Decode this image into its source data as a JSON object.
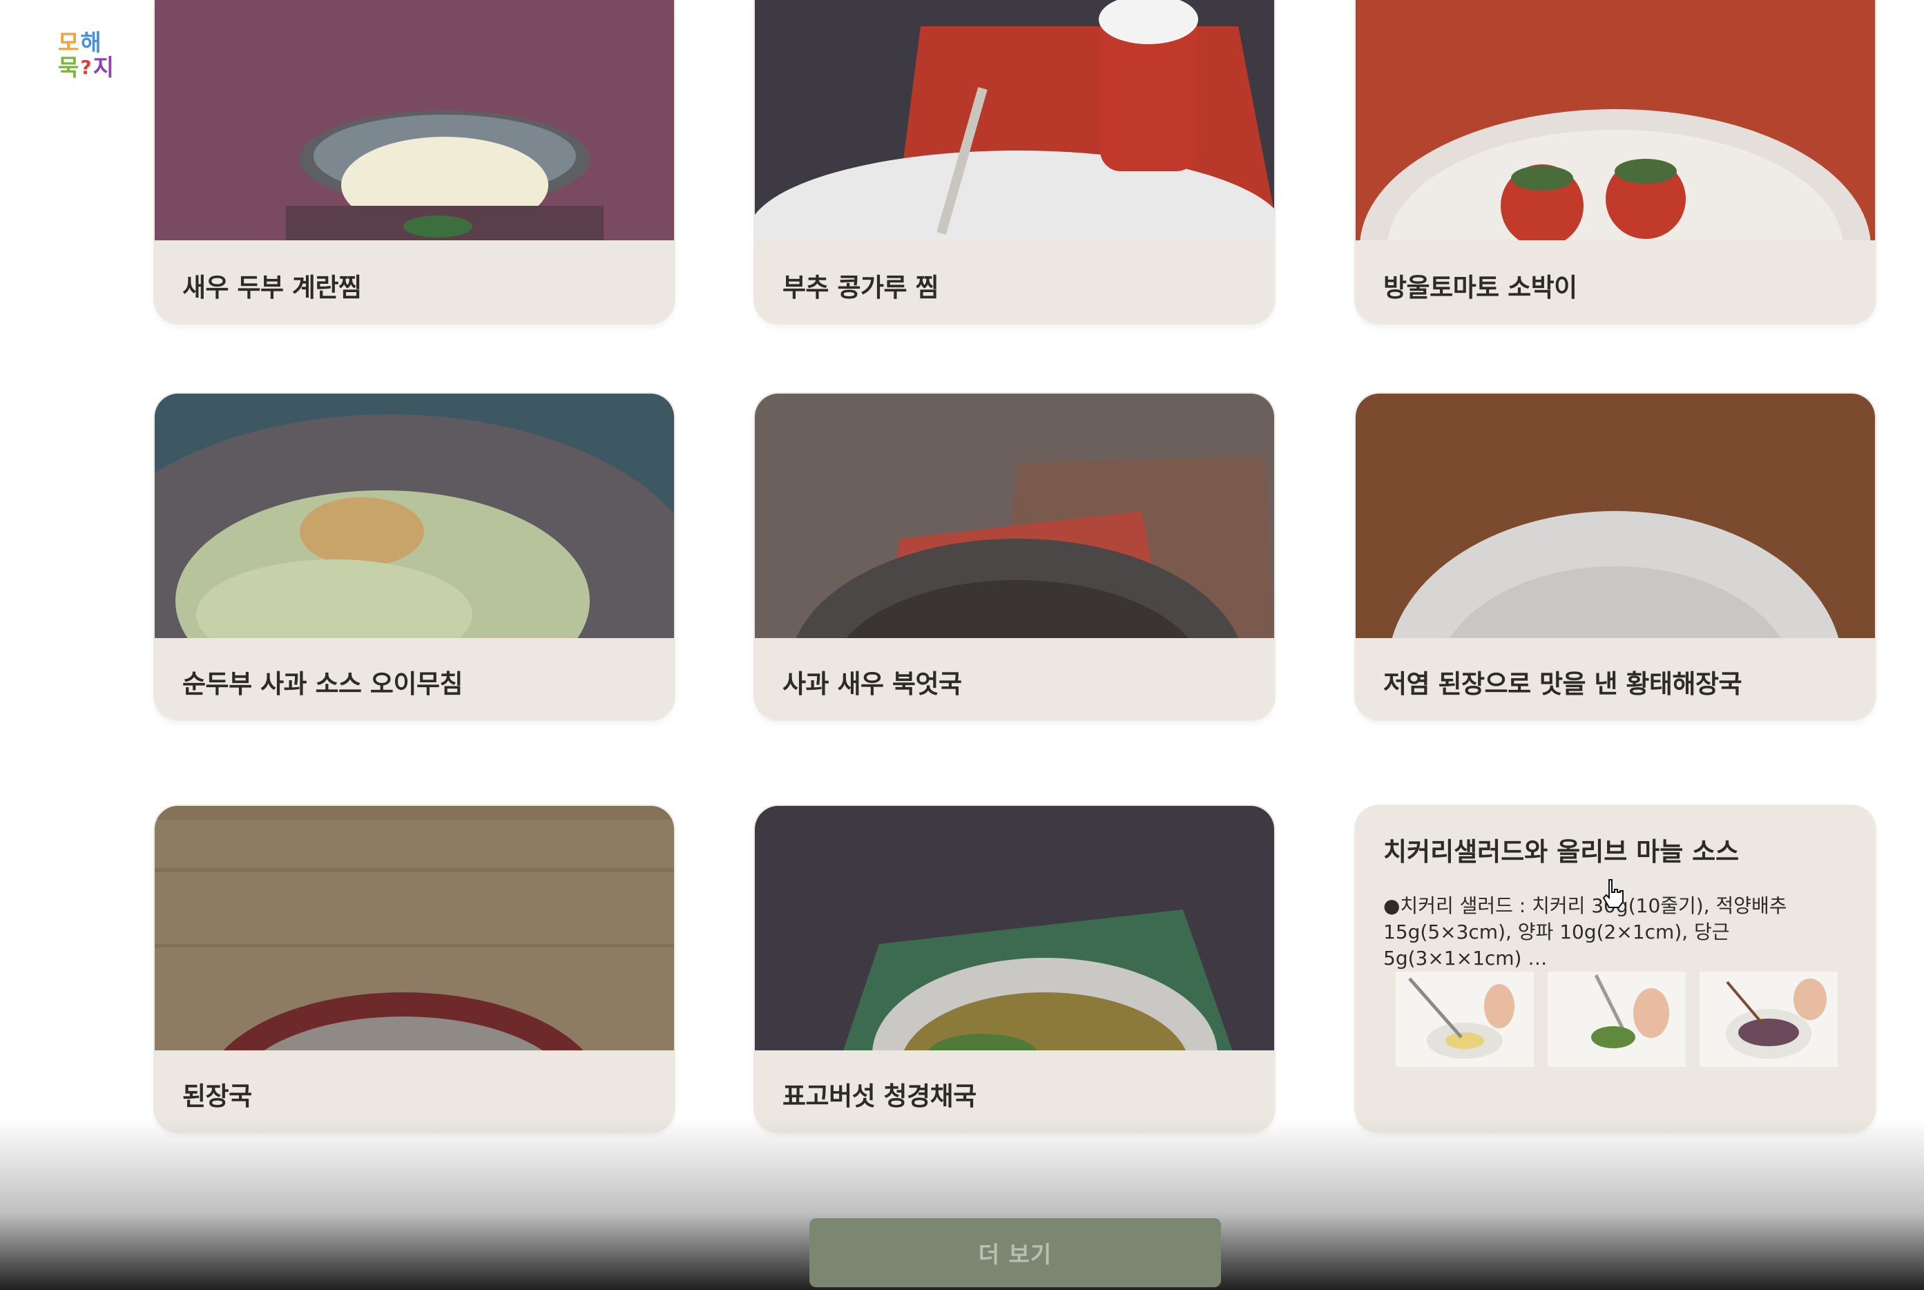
{
  "logo": {
    "chars": [
      "모",
      "해",
      "묵",
      "?",
      "지"
    ],
    "colors": [
      "#f2a43a",
      "#4a90d9",
      "#7cb342",
      "#e53935",
      "#8e44ad"
    ]
  },
  "recipes": [
    {
      "title": "새우 두부 계란찜",
      "photo": "steamed-egg-bowl"
    },
    {
      "title": "부추 콩가루 찜",
      "photo": "plate-spoon-cup"
    },
    {
      "title": "방울토마토 소박이",
      "photo": "stuffed-tomatoes"
    },
    {
      "title": "순두부 사과 소스 오이무침",
      "photo": "cucumber-salad"
    },
    {
      "title": "사과 새우 북엇국",
      "photo": "soup-metal-bowl"
    },
    {
      "title": "저염 된장으로 맛을 낸 황태해장국",
      "photo": "soup-white-bowl"
    },
    {
      "title": "된장국",
      "photo": "doenjang-soup"
    },
    {
      "title": "표고버섯 청경채국",
      "photo": "mushroom-bokchoy-soup"
    }
  ],
  "detail_card": {
    "title": "치커리샐러드와 올리브 마늘 소스",
    "description": "●치커리 샐러드 : 치커리 30g(10줄기), 적양배추 15g(5×3cm), 양파 10g(2×1cm), 당근 5g(3×1×1cm) …",
    "step_images": [
      "whisking-dressing",
      "cutting-greens",
      "tossing-salad"
    ]
  },
  "more_button": {
    "label": "더 보기"
  }
}
